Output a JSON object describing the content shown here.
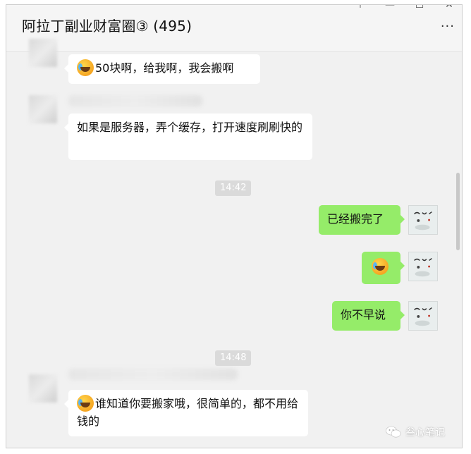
{
  "window": {
    "title": "阿拉丁副业财富圈③ (495)",
    "minimize_glyph": "—",
    "maximize_glyph": "☐",
    "close_glyph": "✕",
    "pin_glyph": "⊤",
    "more_glyph": "···"
  },
  "messages": [
    {
      "side": "left",
      "has_emoji": true,
      "emoji_icon": "laugh-cry-emoji",
      "text": "50块啊，给我啊，我会搬啊"
    },
    {
      "side": "left",
      "has_emoji": false,
      "text": "如果是服务器，弄个缓存，打开速度刷刷快的"
    },
    {
      "type": "time",
      "text": "14:42"
    },
    {
      "side": "right",
      "text": "已经搬完了"
    },
    {
      "side": "right",
      "emoji_only": true,
      "emoji_icon": "laugh-cry-emoji"
    },
    {
      "side": "right",
      "text": "你不早说"
    },
    {
      "type": "time",
      "text": "14:48"
    },
    {
      "side": "left",
      "has_emoji": true,
      "emoji_icon": "laugh-cry-emoji",
      "text": "谁知道你要搬家哦，很简单的，都不用给钱的"
    }
  ],
  "watermark": {
    "text": "叁心笔记"
  },
  "colors": {
    "chat_bg": "#f1f1f1",
    "outgoing_bubble": "#95ec69",
    "incoming_bubble": "#ffffff",
    "time_pill": "#dadada"
  }
}
